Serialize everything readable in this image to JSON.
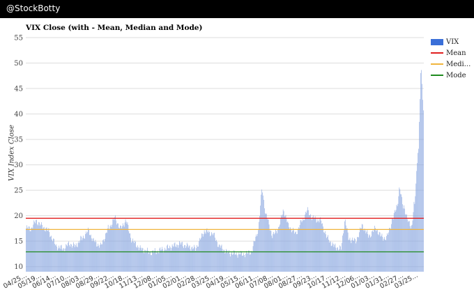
{
  "header": {
    "brand": "@StockBotty"
  },
  "colors": {
    "bars": "#8aa7e0",
    "bar_swatch": "#3a6fd8",
    "mean": "#e01f1f",
    "median": "#f0b43c",
    "mode": "#1e8a1e",
    "grid": "#dddddd"
  },
  "chart_data": {
    "type": "bar",
    "title": "VIX Close (with - Mean, Median and Mode)",
    "ylabel": "VIX Index Close",
    "xlabel": "",
    "ylim": [
      9,
      55
    ],
    "yticks": [
      10,
      15,
      20,
      25,
      30,
      35,
      40,
      45,
      50,
      55
    ],
    "xticks": [
      "04/25...",
      "05/19...",
      "06/14...",
      "07/10...",
      "08/03...",
      "08/29...",
      "09/22...",
      "10/18...",
      "11/13...",
      "12/08...",
      "01/05...",
      "02/01...",
      "02/28...",
      "03/25...",
      "04/19...",
      "05/15...",
      "06/11...",
      "07/08...",
      "08/01...",
      "08/27...",
      "09/23...",
      "10/17...",
      "11/12...",
      "12/06...",
      "01/03...",
      "01/31...",
      "02/27...",
      "03/25..."
    ],
    "segments": [
      [
        8,
        17.5
      ],
      [
        8,
        19
      ],
      [
        8,
        18
      ],
      [
        10,
        17
      ],
      [
        12,
        14
      ],
      [
        10,
        13.5
      ],
      [
        10,
        14.5
      ],
      [
        8,
        14
      ],
      [
        10,
        15.5
      ],
      [
        10,
        17
      ],
      [
        8,
        15
      ],
      [
        10,
        14
      ],
      [
        12,
        17.5
      ],
      [
        10,
        19.5
      ],
      [
        8,
        17.5
      ],
      [
        8,
        19
      ],
      [
        10,
        15
      ],
      [
        12,
        13.5
      ],
      [
        14,
        12.8
      ],
      [
        10,
        13
      ],
      [
        12,
        13.5
      ],
      [
        12,
        14
      ],
      [
        12,
        14.5
      ],
      [
        10,
        14
      ],
      [
        12,
        13.5
      ],
      [
        14,
        17
      ],
      [
        12,
        16.5
      ],
      [
        10,
        14
      ],
      [
        12,
        12.8
      ],
      [
        14,
        12.5
      ],
      [
        14,
        12.5
      ],
      [
        8,
        13
      ],
      [
        10,
        17
      ],
      [
        6,
        25
      ],
      [
        6,
        20
      ],
      [
        10,
        16
      ],
      [
        8,
        17.5
      ],
      [
        8,
        21
      ],
      [
        8,
        18
      ],
      [
        10,
        16.5
      ],
      [
        10,
        19
      ],
      [
        8,
        21
      ],
      [
        8,
        19.5
      ],
      [
        12,
        19
      ],
      [
        10,
        15.5
      ],
      [
        10,
        14
      ],
      [
        10,
        13.5
      ],
      [
        6,
        19
      ],
      [
        6,
        15.5
      ],
      [
        10,
        15
      ],
      [
        10,
        18
      ],
      [
        10,
        16
      ],
      [
        10,
        17.5
      ],
      [
        8,
        16
      ],
      [
        8,
        15.5
      ],
      [
        10,
        19.5
      ],
      [
        6,
        22
      ],
      [
        4,
        25
      ],
      [
        6,
        22
      ],
      [
        6,
        19
      ],
      [
        6,
        18
      ],
      [
        4,
        22
      ],
      [
        6,
        33
      ],
      [
        4,
        48
      ],
      [
        4,
        41
      ]
    ],
    "series": [
      {
        "name": "VIX",
        "style": "bar"
      },
      {
        "name": "Mean",
        "style": "line",
        "value": 19.5
      },
      {
        "name": "Medi...",
        "style": "line",
        "value": 17.3
      },
      {
        "name": "Mode",
        "style": "line",
        "value": 12.9
      }
    ],
    "grid": true,
    "legend": "top-right"
  }
}
